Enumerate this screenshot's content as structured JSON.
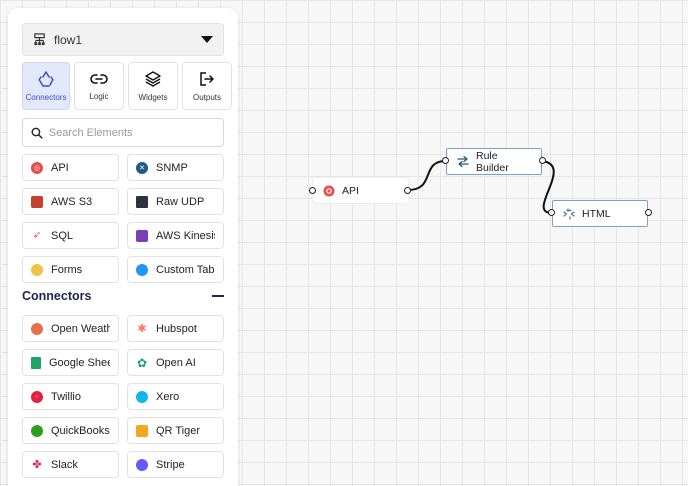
{
  "flow": {
    "name": "flow1"
  },
  "tabs": [
    {
      "label": "Connectors",
      "icon": "recycle-icon",
      "active": true
    },
    {
      "label": "Logic",
      "icon": "link-icon",
      "active": false
    },
    {
      "label": "Widgets",
      "icon": "layers-icon",
      "active": false
    },
    {
      "label": "Outputs",
      "icon": "exit-icon",
      "active": false
    }
  ],
  "search": {
    "placeholder": "Search Elements"
  },
  "elements": [
    {
      "label": "API",
      "icon": "api-icon",
      "color": "#e84b4b"
    },
    {
      "label": "SNMP",
      "icon": "snmp-icon",
      "color": "#1f5c8a"
    },
    {
      "label": "AWS S3",
      "icon": "aws-s3-icon",
      "color": "#c7402e"
    },
    {
      "label": "Raw UDP",
      "icon": "raw-udp-icon",
      "color": "#2b3440"
    },
    {
      "label": "SQL",
      "icon": "sql-icon",
      "color": "#d9534f"
    },
    {
      "label": "AWS Kinesis",
      "icon": "aws-kinesis-icon",
      "color": "#7b3fb5"
    },
    {
      "label": "Forms",
      "icon": "forms-icon",
      "color": "#f0c24a"
    },
    {
      "label": "Custom Tabl",
      "icon": "custom-table-icon",
      "color": "#2196f3"
    }
  ],
  "connectors_section": {
    "title": "Connectors"
  },
  "connectors": [
    {
      "label": "Open Weath",
      "icon": "open-weather-icon",
      "color": "#eb6e4b"
    },
    {
      "label": "Hubspot",
      "icon": "hubspot-icon",
      "color": "#ff7a59"
    },
    {
      "label": "Google Shee",
      "icon": "google-sheets-icon",
      "color": "#1fa463"
    },
    {
      "label": "Open AI",
      "icon": "openai-icon",
      "color": "#10a37f"
    },
    {
      "label": "Twillio",
      "icon": "twilio-icon",
      "color": "#e31e3a"
    },
    {
      "label": "Xero",
      "icon": "xero-icon",
      "color": "#13b5ea"
    },
    {
      "label": "QuickBooks",
      "icon": "quickbooks-icon",
      "color": "#2ca01c"
    },
    {
      "label": "QR Tiger",
      "icon": "qr-tiger-icon",
      "color": "#f5a623"
    },
    {
      "label": "Slack",
      "icon": "slack-icon",
      "color": "#4a154b"
    },
    {
      "label": "Stripe",
      "icon": "stripe-icon",
      "color": "#635bff"
    }
  ],
  "canvas": {
    "nodes": [
      {
        "id": "api",
        "label": "API",
        "icon": "api-icon"
      },
      {
        "id": "rule",
        "label": "Rule Builder",
        "icon": "swap-icon"
      },
      {
        "id": "html",
        "label": "HTML",
        "icon": "html-icon"
      }
    ]
  }
}
